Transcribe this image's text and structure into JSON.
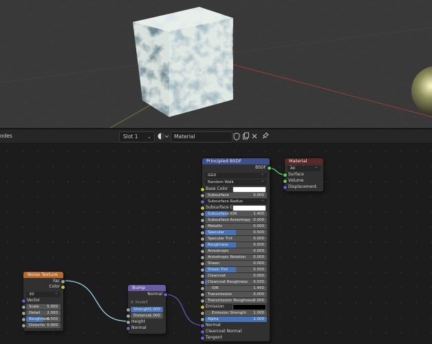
{
  "header": {
    "editor_label": "odes",
    "slot": "Slot 1",
    "material_name": "Material"
  },
  "colors": {
    "texture_header": "#b86a2c",
    "vector_header": "#6c5aa6",
    "shader_header": "#3f4f8a",
    "output_header": "#5a2828",
    "float_socket": "#a1a1a1",
    "color_socket": "#c7c729",
    "vector_socket": "#6363c7",
    "shader_socket": "#63c763",
    "field_fill": "#4772b3"
  },
  "noise": {
    "title": "Noise Texture",
    "out_fac": "Fac",
    "out_color": "Color",
    "dimensions": "3D",
    "in_vector": "Vector",
    "scale_label": "Scale",
    "scale": "5.000",
    "detail_label": "Detail",
    "detail": "2.000",
    "roughness_label": "Roughness",
    "roughness": "0.500",
    "roughness_fill": 0.5,
    "distortion_label": "Distortio",
    "distortion": "0.000"
  },
  "bump": {
    "title": "Bump",
    "out_normal": "Normal",
    "invert": "Invert",
    "strength_label": "Strength",
    "strength": "1.000",
    "strength_fill": 1.0,
    "distance_label": "Distance",
    "distance": "1.000",
    "in_height": "Height",
    "in_normal": "Normal"
  },
  "bsdf": {
    "title": "Principled BSDF",
    "out": "BSDF",
    "distribution": "GGX",
    "subsurface_method": "Random Walk",
    "inputs": [
      {
        "name": "Base Color",
        "kind": "color",
        "socket": "color",
        "color": "#ffffff"
      },
      {
        "name": "Subsurface",
        "value": "0.000",
        "socket": "float",
        "fill": 0
      },
      {
        "name": "Subsurface Radius",
        "kind": "dropdown",
        "socket": "vector"
      },
      {
        "name": "Subsurface C...",
        "kind": "color",
        "socket": "color",
        "color": "#ffffff"
      },
      {
        "name": "Subsurface IOR",
        "value": "1.400",
        "socket": "float",
        "fill": 0.35
      },
      {
        "name": "Subsurface Anisotropy",
        "value": "0.000",
        "socket": "float",
        "fill": 0
      },
      {
        "name": "Metallic",
        "value": "0.000",
        "socket": "float",
        "fill": 0
      },
      {
        "name": "Specular",
        "value": "0.500",
        "socket": "float",
        "fill": 0.5
      },
      {
        "name": "Specular Tint",
        "value": "0.000",
        "socket": "float",
        "fill": 0
      },
      {
        "name": "Roughness",
        "value": "0.500",
        "socket": "float",
        "fill": 0.5
      },
      {
        "name": "Anisotropic",
        "value": "0.000",
        "socket": "float",
        "fill": 0
      },
      {
        "name": "Anisotropic Rotation",
        "value": "0.000",
        "socket": "float",
        "fill": 0
      },
      {
        "name": "Sheen",
        "value": "0.000",
        "socket": "float",
        "fill": 0
      },
      {
        "name": "Sheen Tint",
        "value": "0.500",
        "socket": "float",
        "fill": 0.5
      },
      {
        "name": "Clearcoat",
        "value": "0.000",
        "socket": "float",
        "fill": 0
      },
      {
        "name": "Clearcoat Roughness",
        "value": "0.030",
        "socket": "float",
        "fill": 0.03
      },
      {
        "name": "IOR",
        "value": "1.450",
        "socket": "float",
        "fill": 0,
        "centered": true
      },
      {
        "name": "Transmission",
        "value": "0.000",
        "socket": "float",
        "fill": 0
      },
      {
        "name": "Transmission Roughness",
        "value": "0.000",
        "socket": "float",
        "fill": 0
      },
      {
        "name": "Emission",
        "kind": "color",
        "socket": "color",
        "color": "#000000"
      },
      {
        "name": "Emission Strength",
        "value": "1.000",
        "socket": "float",
        "fill": 0,
        "centered": true
      },
      {
        "name": "Alpha",
        "value": "1.000",
        "socket": "float",
        "fill": 1
      },
      {
        "name": "Normal",
        "kind": "label",
        "socket": "vector"
      },
      {
        "name": "Clearcoat Normal",
        "kind": "label",
        "socket": "vector"
      },
      {
        "name": "Tangent",
        "kind": "label",
        "socket": "vector"
      }
    ]
  },
  "output": {
    "title": "Material Output",
    "target": "All",
    "in_surface": "Surface",
    "in_volume": "Volume",
    "in_displacement": "Displacement"
  }
}
